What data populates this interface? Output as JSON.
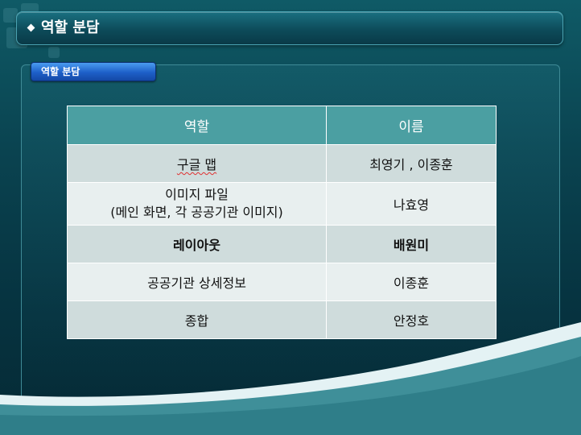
{
  "slide": {
    "title": "역할 분담",
    "section_label": "역할 분담"
  },
  "table": {
    "headers": [
      "역할",
      "이름"
    ],
    "rows": [
      {
        "role": "구글 맵",
        "name": "최영기 , 이종훈"
      },
      {
        "role_line1": "이미지 파일",
        "role_line2": "(메인 화면, 각 공공기관 이미지)",
        "name": "나효영"
      },
      {
        "role": "레이아웃",
        "name": "배원미"
      },
      {
        "role": "공공기관 상세정보",
        "name": "이종훈"
      },
      {
        "role": "종합",
        "name": "안정호"
      }
    ]
  },
  "colors": {
    "header_bg": "#4b9fa2",
    "row_dark": "#cfdcdc",
    "row_light": "#e8efef",
    "section_label_blue": "#1d5fc8",
    "background": "#0a4350"
  },
  "icons": {
    "title_bullet": "diamond-bullet-icon"
  }
}
